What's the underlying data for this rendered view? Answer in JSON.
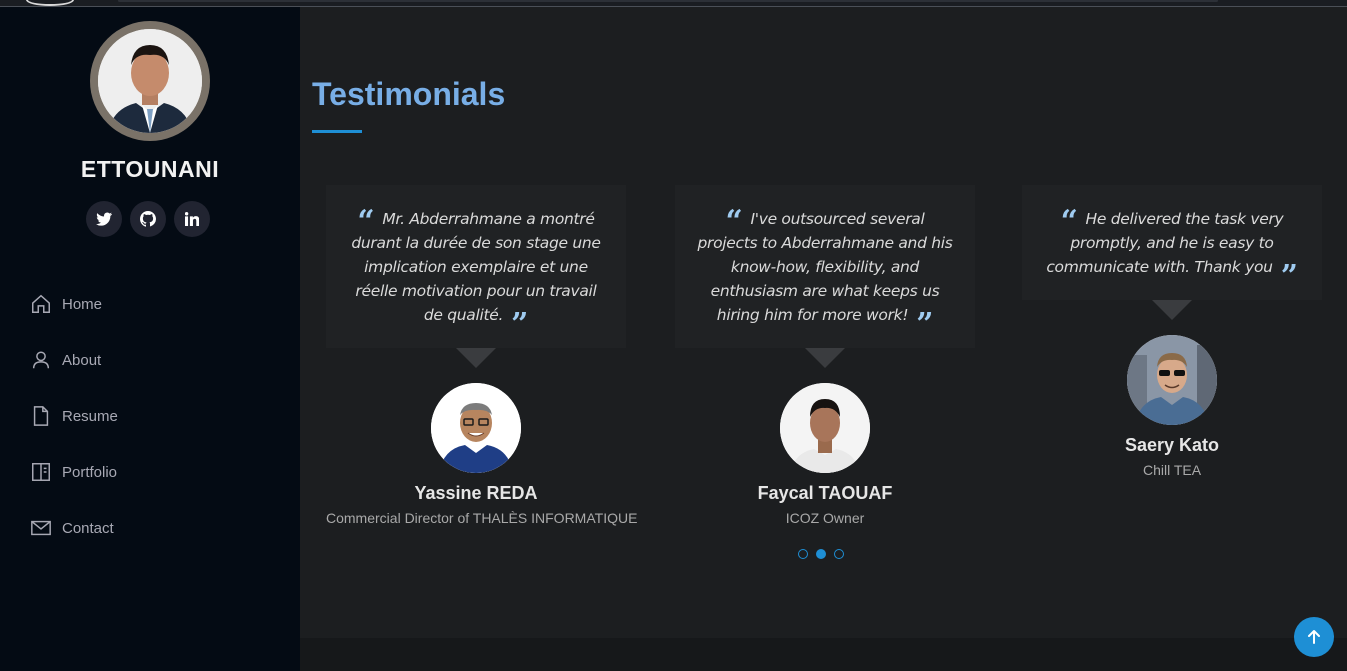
{
  "profile": {
    "name": "ETTOUNANI",
    "social": [
      "twitter-icon",
      "github-icon",
      "linkedin-icon"
    ]
  },
  "nav": [
    {
      "label": "Home",
      "icon": "home-icon"
    },
    {
      "label": "About",
      "icon": "person-icon"
    },
    {
      "label": "Resume",
      "icon": "file-icon"
    },
    {
      "label": "Portfolio",
      "icon": "book-icon"
    },
    {
      "label": "Contact",
      "icon": "envelope-icon"
    }
  ],
  "section": {
    "title": "Testimonials"
  },
  "testimonials": [
    {
      "quote": "Mr. Abderrahmane a montré durant la durée de son stage une implication exemplaire et une réelle motivation pour un travail de qualité.",
      "name": "Yassine REDA",
      "role": "Commercial Director of THALÈS INFORMATIQUE"
    },
    {
      "quote": "I've outsourced several projects to Abderrahmane and his know-how, flexibility, and enthusiasm are what keeps us hiring him for more work!",
      "name": "Faycal TAOUAF",
      "role": "ICOZ Owner"
    },
    {
      "quote": "He delivered the task very promptly, and he is easy to communicate with. Thank you",
      "name": "Saery Kato",
      "role": "Chill TEA"
    }
  ],
  "pagination": {
    "count": 3,
    "active_index": 1
  },
  "colors": {
    "accent": "#1e8fd5",
    "title": "#78aee6",
    "sidebar_bg": "#040b14",
    "main_bg": "#1c1e20"
  }
}
